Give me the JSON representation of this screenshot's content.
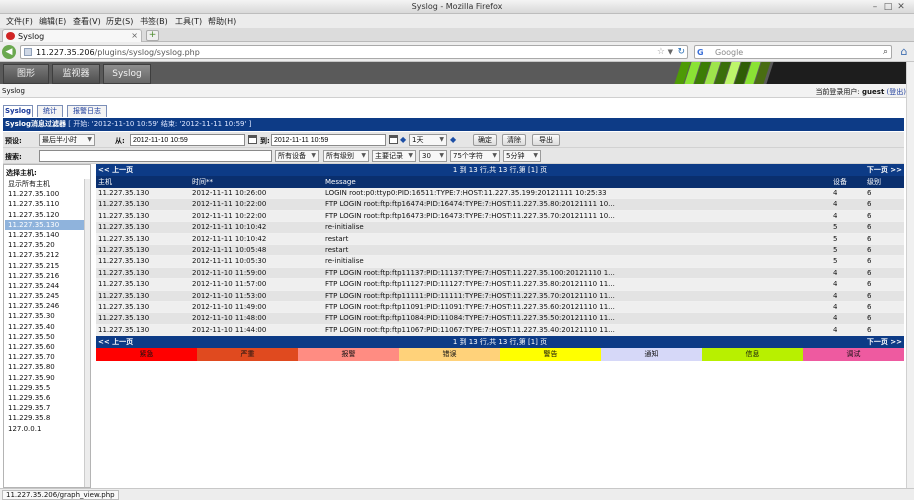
{
  "window": {
    "title": "Syslog - Mozilla Firefox"
  },
  "menu": [
    "文件(F)",
    "编辑(E)",
    "查看(V)",
    "历史(S)",
    "书签(B)",
    "工具(T)",
    "帮助(H)"
  ],
  "tab": {
    "label": "Syslog",
    "close": "×"
  },
  "newtab": "+",
  "nav": {
    "url_host": "11.227.35.206",
    "url_path": "/plugins/syslog/syslog.php",
    "search_placeholder": "Google",
    "search_engine": "G"
  },
  "cacti_tabs": [
    "图形",
    "监视器",
    "Syslog"
  ],
  "crumb": {
    "left": "Syslog",
    "login_prefix": "当前登录用户:",
    "user": "guest",
    "logout": "(登出)"
  },
  "inner_tabs": [
    "Syslog",
    "统计",
    "报警日志"
  ],
  "filter": {
    "header_title": "Syslog消息过滤器",
    "header_range": "[ 开始: '2012-11-10 10:59' 结束: '2012-11-11 10:59' ]",
    "preset_label": "预设:",
    "preset_value": "最后半小时",
    "from_label": "从:",
    "from_value": "2012-11-10 10:59",
    "to_label": "到:",
    "to_value": "2012-11-11 10:59",
    "span_value": "1天",
    "btn_ok": "确定",
    "btn_clear": "清除",
    "btn_export": "导出",
    "search_label": "搜索:",
    "search_value": "",
    "device": "所有设备",
    "level": "所有级别",
    "record": "主要记录",
    "rows": "30",
    "chars": "75个字符",
    "refresh": "5分钟"
  },
  "hosts": {
    "title": "选择主机:",
    "selected_index": 4,
    "items": [
      "显示所有主机",
      "11.227.35.100",
      "11.227.35.110",
      "11.227.35.120",
      "11.227.35.130",
      "11.227.35.140",
      "11.227.35.20",
      "11.227.35.212",
      "11.227.35.215",
      "11.227.35.216",
      "11.227.35.244",
      "11.227.35.245",
      "11.227.35.246",
      "11.227.35.30",
      "11.227.35.40",
      "11.227.35.50",
      "11.227.35.60",
      "11.227.35.70",
      "11.227.35.80",
      "11.227.35.90",
      "11.229.35.5",
      "11.229.35.6",
      "11.229.35.7",
      "11.229.35.8",
      "127.0.0.1"
    ]
  },
  "logs": {
    "prev": "<< 上一页",
    "next": "下一页 >>",
    "page_info": "1 到 13 行,共 13 行,第 [1] 页",
    "columns": {
      "host": "主机",
      "time": "时间**",
      "message": "Message",
      "device": "设备",
      "level": "级别"
    },
    "rows": [
      {
        "host": "11.227.35.130",
        "time": "2012-11-11 10:26:00",
        "message": "LOGIN root:p0:ttyp0:PID:16511:TYPE:7:HOST:11.227.35.199:20121111 10:25:33",
        "device": "4",
        "level": "6"
      },
      {
        "host": "11.227.35.130",
        "time": "2012-11-11 10:22:00",
        "message": "FTP LOGIN root:ftp:ftp16474:PID:16474:TYPE:7:HOST:11.227.35.80:20121111 10...",
        "device": "4",
        "level": "6"
      },
      {
        "host": "11.227.35.130",
        "time": "2012-11-11 10:22:00",
        "message": "FTP LOGIN root:ftp:ftp16473:PID:16473:TYPE:7:HOST:11.227.35.70:20121111 10...",
        "device": "4",
        "level": "6"
      },
      {
        "host": "11.227.35.130",
        "time": "2012-11-11 10:10:42",
        "message": "re-initialise",
        "device": "5",
        "level": "6"
      },
      {
        "host": "11.227.35.130",
        "time": "2012-11-11 10:10:42",
        "message": "restart",
        "device": "5",
        "level": "6"
      },
      {
        "host": "11.227.35.130",
        "time": "2012-11-11 10:05:48",
        "message": "restart",
        "device": "5",
        "level": "6"
      },
      {
        "host": "11.227.35.130",
        "time": "2012-11-11 10:05:30",
        "message": "re-initialise",
        "device": "5",
        "level": "6"
      },
      {
        "host": "11.227.35.130",
        "time": "2012-11-10 11:59:00",
        "message": "FTP LOGIN root:ftp:ftp11137:PID:11137:TYPE:7:HOST:11.227.35.100:20121110 1...",
        "device": "4",
        "level": "6"
      },
      {
        "host": "11.227.35.130",
        "time": "2012-11-10 11:57:00",
        "message": "FTP LOGIN root:ftp:ftp11127:PID:11127:TYPE:7:HOST:11.227.35.80:20121110 11...",
        "device": "4",
        "level": "6"
      },
      {
        "host": "11.227.35.130",
        "time": "2012-11-10 11:53:00",
        "message": "FTP LOGIN root:ftp:ftp11111:PID:11111:TYPE:7:HOST:11.227.35.70:20121110 11...",
        "device": "4",
        "level": "6"
      },
      {
        "host": "11.227.35.130",
        "time": "2012-11-10 11:49:00",
        "message": "FTP LOGIN root:ftp:ftp11091:PID:11091:TYPE:7:HOST:11.227.35.60:20121110 11...",
        "device": "4",
        "level": "6"
      },
      {
        "host": "11.227.35.130",
        "time": "2012-11-10 11:48:00",
        "message": "FTP LOGIN root:ftp:ftp11084:PID:11084:TYPE:7:HOST:11.227.35.50:20121110 11...",
        "device": "4",
        "level": "6"
      },
      {
        "host": "11.227.35.130",
        "time": "2012-11-10 11:44:00",
        "message": "FTP LOGIN root:ftp:ftp11067:PID:11067:TYPE:7:HOST:11.227.35.40:20121110 11...",
        "device": "4",
        "level": "6"
      }
    ]
  },
  "legend": [
    {
      "label": "紧急",
      "color": "#ff0000"
    },
    {
      "label": "严重",
      "color": "#e04a1f"
    },
    {
      "label": "报警",
      "color": "#ff8c82"
    },
    {
      "label": "错误",
      "color": "#ffd27a"
    },
    {
      "label": "警告",
      "color": "#ffff00"
    },
    {
      "label": "通知",
      "color": "#d6d8f8"
    },
    {
      "label": "信息",
      "color": "#b8f000"
    },
    {
      "label": "调试",
      "color": "#ee5aa0"
    }
  ],
  "status": {
    "text": "11.227.35.206/graph_view.php"
  }
}
